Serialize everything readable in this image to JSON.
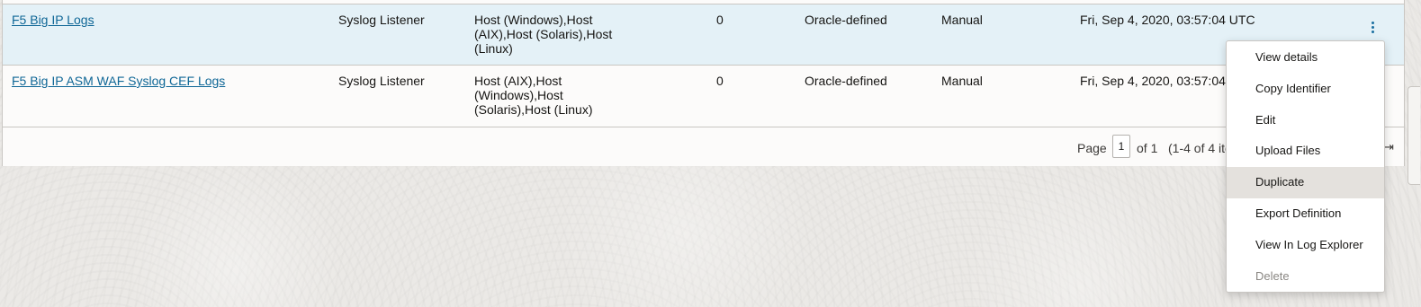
{
  "rows": [
    {
      "name": "F5 Big IP Logs",
      "type": "Syslog Listener",
      "sources": [
        "Host (Windows),Host",
        "(AIX),Host (Solaris),Host",
        "(Linux)"
      ],
      "count": "0",
      "origin": "Oracle-defined",
      "mode": "Manual",
      "date": "Fri, Sep 4, 2020, 03:57:04 UTC"
    },
    {
      "name": "F5 Big IP ASM WAF Syslog CEF Logs",
      "type": "Syslog Listener",
      "sources": [
        "Host (AIX),Host",
        "(Windows),Host",
        "(Solaris),Host (Linux)"
      ],
      "count": "0",
      "origin": "Oracle-defined",
      "mode": "Manual",
      "date": "Fri, Sep 4, 2020, 03:57:04 UTC"
    }
  ],
  "pagination": {
    "page_label": "Page",
    "page_value": "1",
    "of_label": "of 1",
    "range_label": "(1-4 of 4 items)",
    "last_icon": "⇥"
  },
  "menu": {
    "items": [
      {
        "label": "View details",
        "state": "normal"
      },
      {
        "label": "Copy Identifier",
        "state": "normal"
      },
      {
        "label": "Edit",
        "state": "normal"
      },
      {
        "label": "Upload Files",
        "state": "normal"
      },
      {
        "label": "Duplicate",
        "state": "hover"
      },
      {
        "label": "Export Definition",
        "state": "normal"
      },
      {
        "label": "View In Log Explorer",
        "state": "normal"
      },
      {
        "label": "Delete",
        "state": "disabled"
      }
    ]
  },
  "icons": {
    "row_actions": "kebab-menu-icon",
    "last_page": "last-page-icon"
  },
  "colors": {
    "link": "#0e6696",
    "selected_row": "#e4f1f7",
    "menu_hover": "#e4e1dd"
  }
}
